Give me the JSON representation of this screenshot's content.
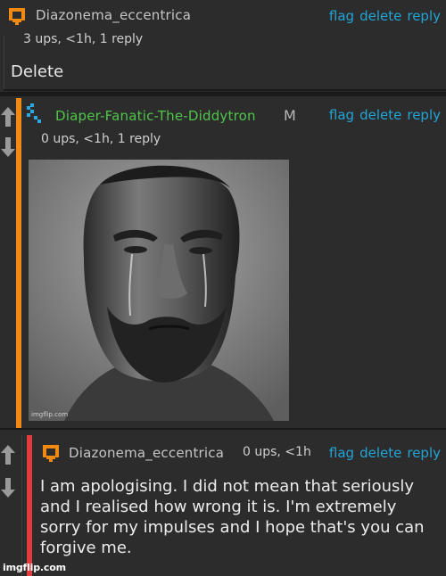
{
  "comments": [
    {
      "username": "Diazonema_eccentrica",
      "meta": "3 ups, <1h, 1 reply",
      "body": "Delete",
      "actions": {
        "flag": "flag",
        "delete": "delete",
        "reply": "reply"
      },
      "avatar_icon": "pixel-avatar-icon",
      "avatar_color": "#f08a13"
    },
    {
      "username": "Diaper-Fanatic-The-Diddytron",
      "mod_badge": "M",
      "meta": "0 ups, <1h, 1 reply",
      "actions": {
        "flag": "flag",
        "delete": "delete",
        "reply": "reply"
      },
      "avatar_icon": "pixel-avatar-icon",
      "avatar_color": "#2ea8e0",
      "username_color": "#4fc54a",
      "thread_color": "#f08a13",
      "image_watermark": "imgflip.com"
    },
    {
      "username": "Diazonema_eccentrica",
      "meta": "0 ups, <1h",
      "body": "I am apologising. I did not mean that seriously and I realised how wrong it is. I'm extremely sorry for my impulses and I hope that's you can forgive me.",
      "actions": {
        "flag": "flag",
        "delete": "delete",
        "reply": "reply"
      },
      "avatar_icon": "pixel-avatar-icon",
      "avatar_color": "#f08a13",
      "thread_color": "#e23b3b"
    }
  ],
  "vote_icons": {
    "up": "upvote-arrow-icon",
    "down": "downvote-arrow-icon"
  },
  "watermark": "imgflip.com",
  "accent_link_color": "#22a4d6"
}
